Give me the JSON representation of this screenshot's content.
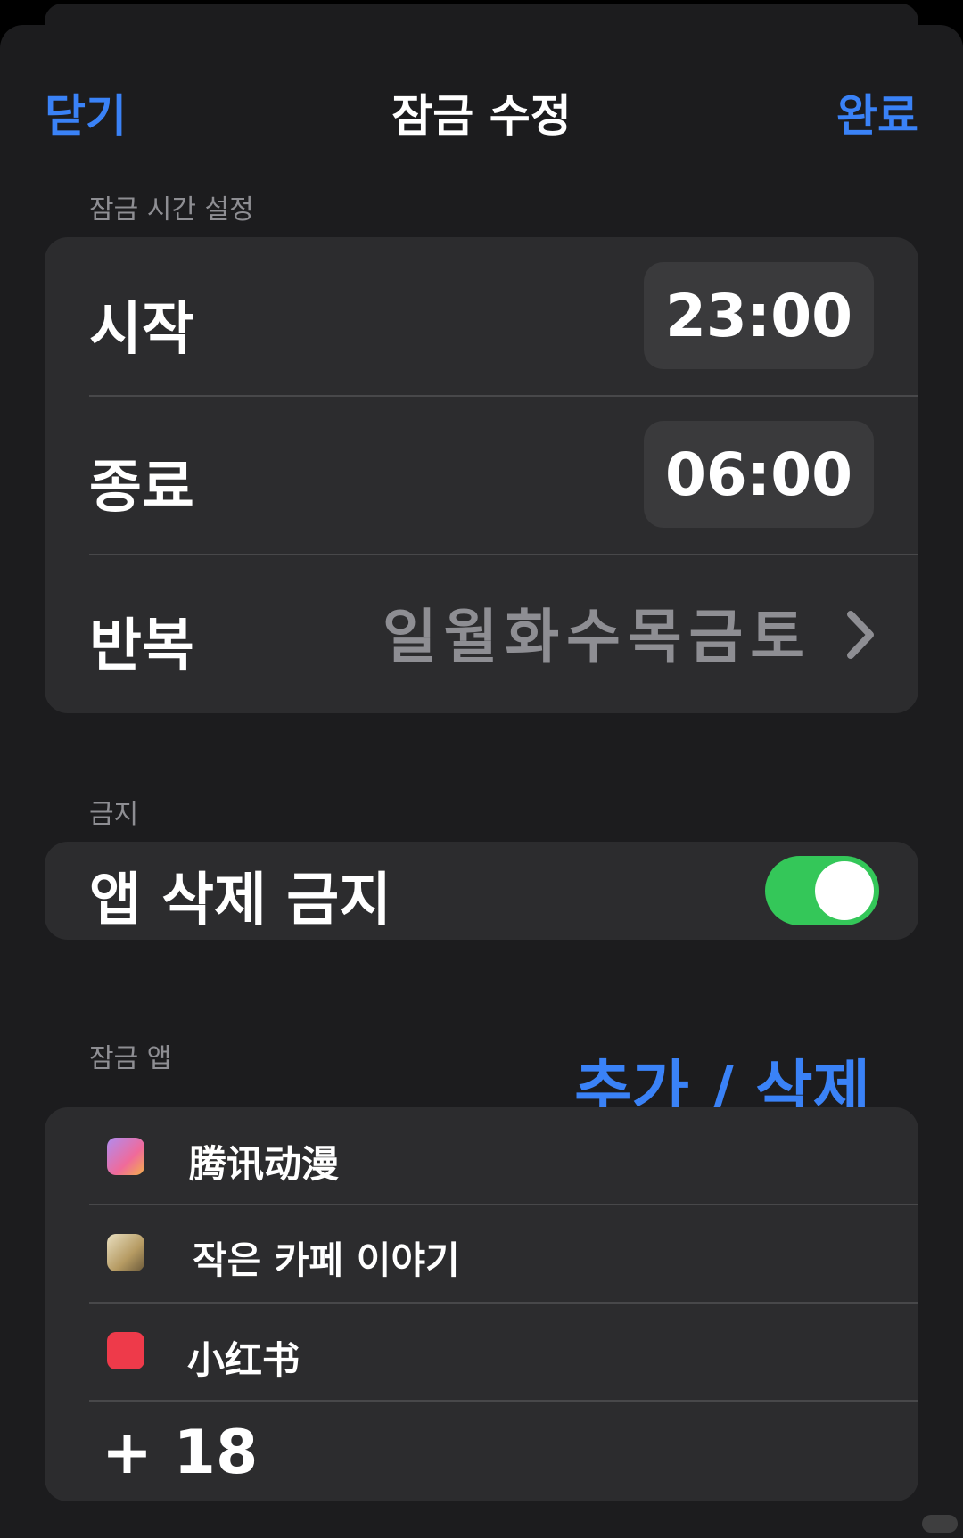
{
  "nav": {
    "close_label": "닫기",
    "title": "잠금 수정",
    "done_label": "완료"
  },
  "schedule": {
    "header": "잠금 시간 설정",
    "start_label": "시작",
    "start_time": "23:00",
    "end_label": "종료",
    "end_time": "06:00",
    "repeat_label": "반복",
    "repeat_days": "일월화수목금토"
  },
  "restrictions": {
    "header": "금지",
    "prevent_delete_label": "앱 삭제 금지",
    "prevent_delete_enabled": true
  },
  "locked_apps": {
    "header": "잠금 앱",
    "add_remove_label": "추가 / 삭제",
    "apps": [
      {
        "name": "腾讯动漫",
        "icon": "tencent-comic-icon"
      },
      {
        "name": "작은 카페 이야기",
        "icon": "cafe-story-icon"
      },
      {
        "name": "小红书",
        "icon": "xiaohongshu-icon"
      }
    ],
    "more_count": "+ 18"
  },
  "colors": {
    "accent": "#3a82f7",
    "toggle_on": "#34c759",
    "background": "#1c1c1e",
    "group": "#2c2c2e"
  }
}
